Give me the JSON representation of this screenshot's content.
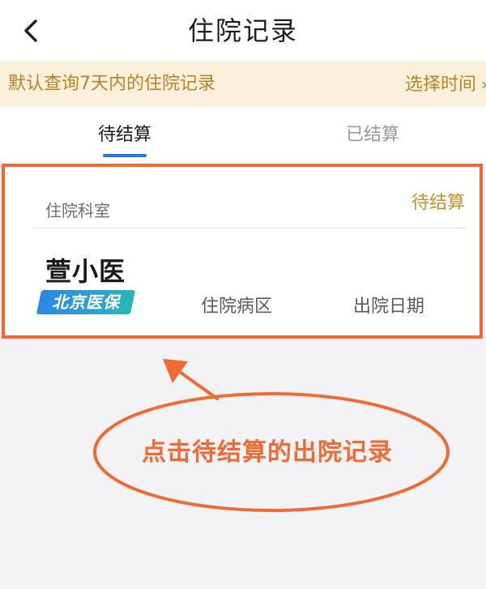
{
  "header": {
    "title": "住院记录",
    "back_icon": "chevron-left-icon"
  },
  "notice": {
    "text": "默认查询7天内的住院记录",
    "action_label": "选择时间",
    "action_icon": "chevron-right-icon"
  },
  "tabs": [
    {
      "label": "待结算",
      "active": true
    },
    {
      "label": "已结算",
      "active": false
    }
  ],
  "record": {
    "department_label": "住院科室",
    "status": "待结算",
    "patient_name": "萱小医",
    "insurance_badge": "北京医保",
    "ward_label": "住院病区",
    "discharge_date_label": "出院日期"
  },
  "annotation": {
    "text": "点击待结算的出院记录"
  },
  "colors": {
    "accent_orange": "#f06a33",
    "gold_text": "#b88526",
    "tab_blue": "#1e7be0",
    "notice_bg": "#fbf0dc"
  }
}
